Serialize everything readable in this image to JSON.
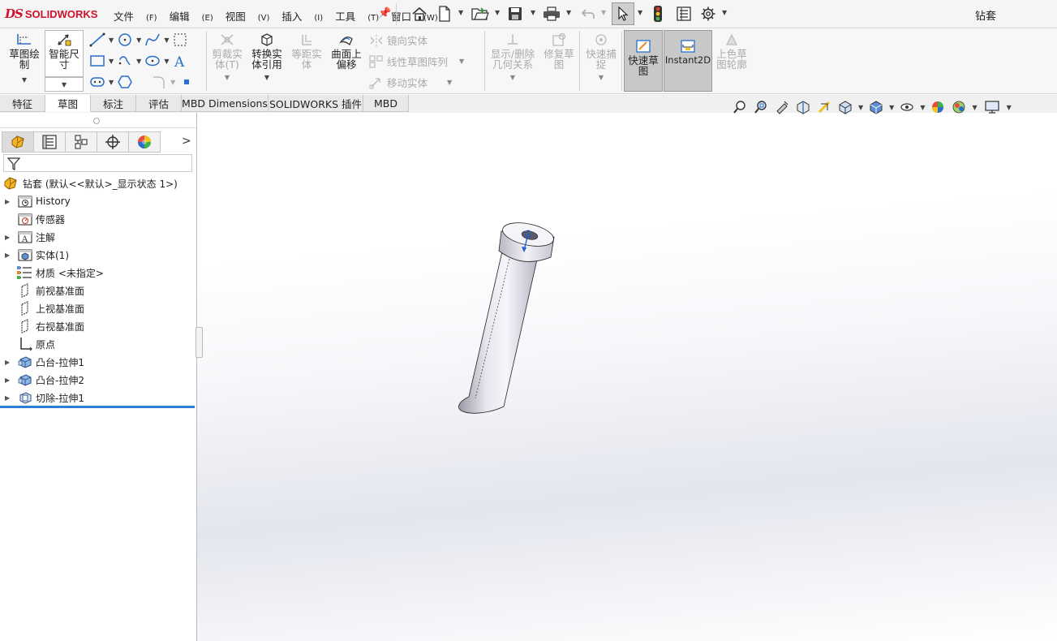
{
  "app": {
    "brand_ds": "DS",
    "brand_name": "SOLIDWORKS",
    "document_title": "钻套"
  },
  "menu": [
    {
      "label": "文件",
      "key": "(F)"
    },
    {
      "label": "编辑",
      "key": "(E)"
    },
    {
      "label": "视图",
      "key": "(V)"
    },
    {
      "label": "插入",
      "key": "(I)"
    },
    {
      "label": "工具",
      "key": "(T)"
    },
    {
      "label": "窗口",
      "key": "(W)"
    }
  ],
  "commands": {
    "sketch": "草图绘\n制",
    "smart_dim": "智能尺\n寸",
    "trim": "剪裁实\n体(T)",
    "convert": "转换实\n体引用",
    "offset": "等距实\n体",
    "surface_offset": "曲面上\n偏移",
    "mirror": "镜向实体",
    "linear_pattern": "线性草图阵列",
    "move": "移动实体",
    "relations": "显示/删除\n几何关系",
    "repair": "修复草\n图",
    "quick_snap": "快速捕\n捉",
    "rapid_sketch": "快速草\n图",
    "instant2d": "Instant2D",
    "shaded_sketch": "上色草\n图轮廓"
  },
  "tabs": [
    "特征",
    "草图",
    "标注",
    "评估",
    "MBD Dimensions",
    "SOLIDWORKS 插件",
    "MBD"
  ],
  "active_tab": "草图",
  "tree": {
    "root": "钻套 (默认<<默认>_显示状态 1>)",
    "items": [
      {
        "label": "History",
        "expandable": true,
        "icon": "history-icon"
      },
      {
        "label": "传感器",
        "expandable": false,
        "icon": "sensor-icon"
      },
      {
        "label": "注解",
        "expandable": true,
        "icon": "annotation-icon"
      },
      {
        "label": "实体(1)",
        "expandable": true,
        "icon": "solid-body-icon"
      },
      {
        "label": "材质 <未指定>",
        "expandable": false,
        "icon": "material-icon"
      },
      {
        "label": "前视基准面",
        "expandable": false,
        "icon": "plane-icon"
      },
      {
        "label": "上视基准面",
        "expandable": false,
        "icon": "plane-icon"
      },
      {
        "label": "右视基准面",
        "expandable": false,
        "icon": "plane-icon"
      },
      {
        "label": "原点",
        "expandable": false,
        "icon": "origin-icon"
      },
      {
        "label": "凸台-拉伸1",
        "expandable": true,
        "icon": "extrude-icon"
      },
      {
        "label": "凸台-拉伸2",
        "expandable": true,
        "icon": "extrude-icon"
      },
      {
        "label": "切除-拉伸1",
        "expandable": true,
        "icon": "cut-extrude-icon"
      }
    ]
  },
  "colors": {
    "brand": "#d0112b",
    "rollback": "#2a7fd4",
    "toolbar_bg": "#f7f7f7",
    "active_button": "#c8c8c8"
  }
}
